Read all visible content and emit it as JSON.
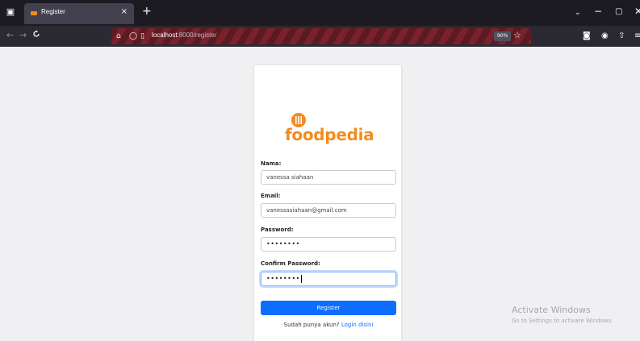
{
  "browser": {
    "tab": {
      "title": "Register",
      "close": "×"
    },
    "new_tab": "+",
    "tab_list_icon": "tab-list-icon",
    "window": {
      "tabs_menu": "⌄",
      "minimize": "−",
      "restore": "▢",
      "close": "✕"
    },
    "nav": {
      "back": "←",
      "forward": "→",
      "reload": "C"
    },
    "url": {
      "host": "localhost",
      "rest": ":8000/register"
    },
    "zoom": "90%",
    "icons": [
      "robot-icon",
      "shield-icon",
      "page-icon",
      "star-icon",
      "pocket-icon",
      "account-icon",
      "extensions-icon",
      "menu-icon"
    ]
  },
  "page": {
    "logo_text": "foodpedia",
    "brand_color": "#f28c1f",
    "form": {
      "name_label": "Nama:",
      "name_value": "vanessa siahaan",
      "email_label": "Email:",
      "email_value": "vanessasiahaan@gmail.com",
      "password_label": "Password:",
      "password_value": "••••••••",
      "confirm_label": "Confirm Password:",
      "confirm_value": "••••••••",
      "submit_label": "Register",
      "submit_color": "#0d6efd"
    },
    "login_prompt": "Sudah punya akun?",
    "login_link": "Login disini"
  },
  "watermark": {
    "title": "Activate Windows",
    "subtitle": "Go to Settings to activate Windows."
  }
}
